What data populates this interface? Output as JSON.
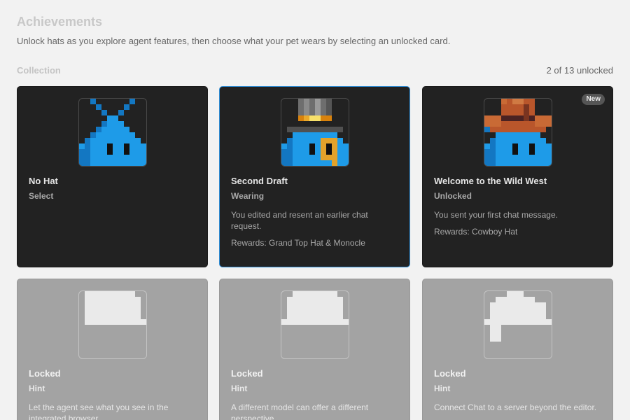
{
  "header": {
    "title": "Achievements",
    "subtitle": "Unlock hats as you explore agent features, then choose what your pet wears by selecting an unlocked card."
  },
  "collection": {
    "label": "Collection",
    "count": "2 of 13 unlocked"
  },
  "cards": [
    {
      "title": "No Hat",
      "status": "Select",
      "description": "",
      "reward": "",
      "badge": "",
      "state": "unlocked",
      "hat_icon": "no-hat-icon"
    },
    {
      "title": "Second Draft",
      "status": "Wearing",
      "description": "You edited and resent an earlier chat request.",
      "reward": "Rewards: Grand Top Hat & Monocle",
      "badge": "",
      "state": "selected",
      "hat_icon": "top-hat-monocle-icon"
    },
    {
      "title": "Welcome to the Wild West",
      "status": "Unlocked",
      "description": "You sent your first chat message.",
      "reward": "Rewards: Cowboy Hat",
      "badge": "New",
      "state": "unlocked",
      "hat_icon": "cowboy-hat-icon"
    },
    {
      "title": "Locked",
      "status": "Hint",
      "description": "Let the agent see what you see in the integrated browser.",
      "reward": "",
      "badge": "",
      "state": "locked",
      "hat_icon": "locked-hat-silhouette-icon"
    },
    {
      "title": "Locked",
      "status": "Hint",
      "description": "A different model can offer a different perspective.",
      "reward": "",
      "badge": "",
      "state": "locked",
      "hat_icon": "locked-hat-silhouette-icon"
    },
    {
      "title": "Locked",
      "status": "Hint",
      "description": "Connect Chat to a server beyond the editor.",
      "reward": "",
      "badge": "",
      "state": "locked",
      "hat_icon": "locked-hat-silhouette-icon"
    }
  ],
  "colors": {
    "background": "#f2f2f2",
    "card_unlocked": "#222222",
    "card_locked": "#a3a3a3",
    "selected_border": "#2f8fd9",
    "pet_blue": "#1e9be8"
  }
}
